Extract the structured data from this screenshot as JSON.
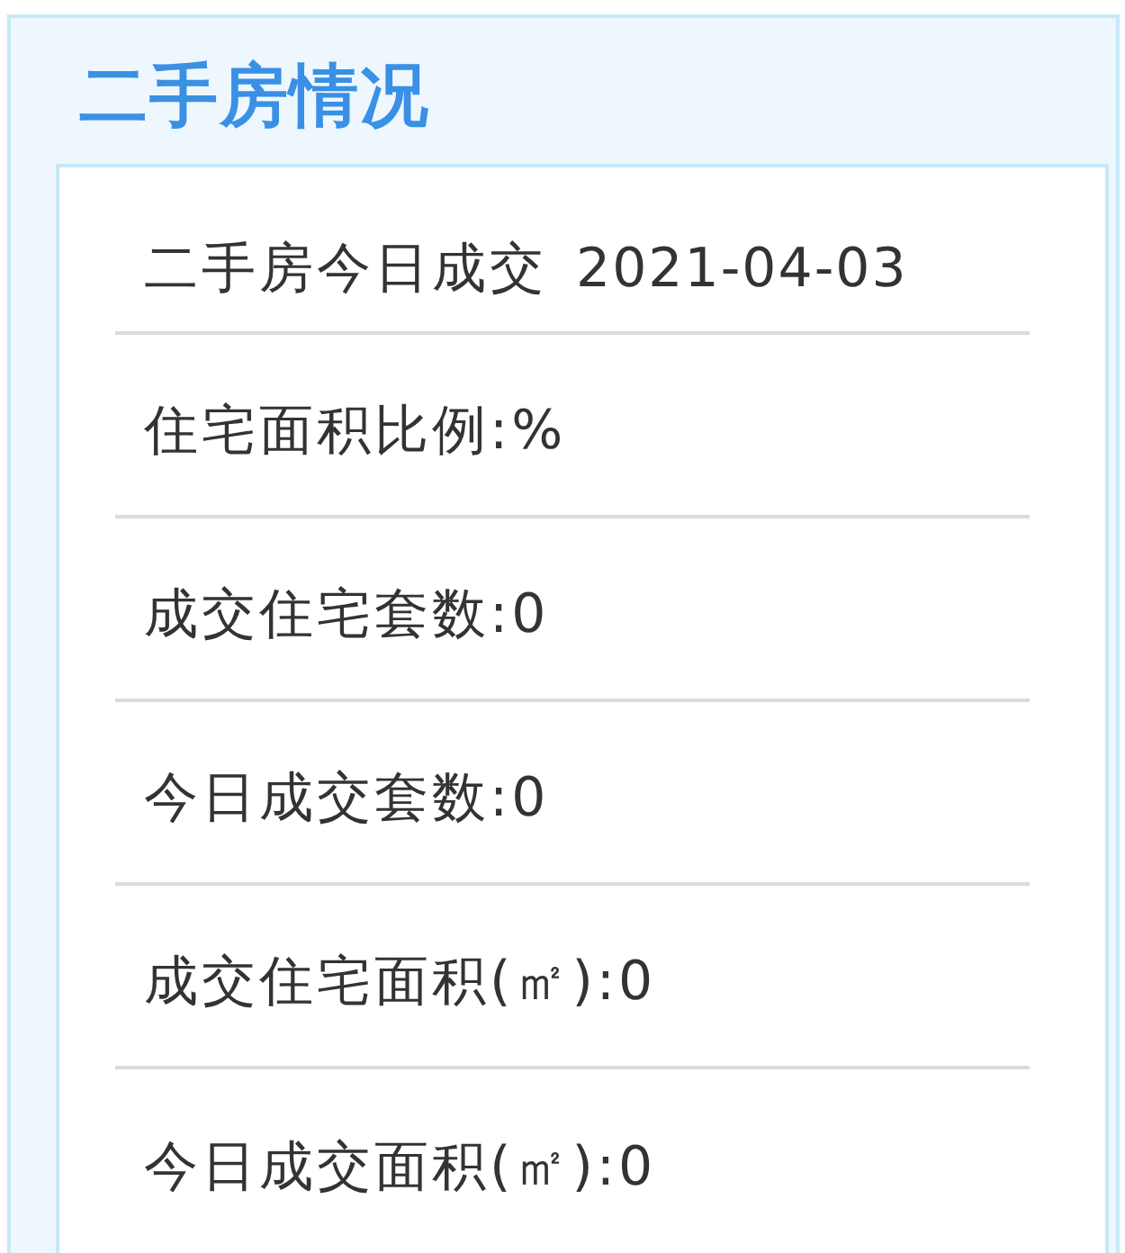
{
  "panel": {
    "title": "二手房情况"
  },
  "stats": {
    "heading": {
      "label": "二手房今日成交",
      "date": "2021-04-03"
    },
    "items": [
      "住宅面积比例:%",
      "成交住宅套数:0",
      "今日成交套数:0",
      "成交住宅面积(㎡):0",
      "今日成交面积(㎡):0"
    ]
  }
}
